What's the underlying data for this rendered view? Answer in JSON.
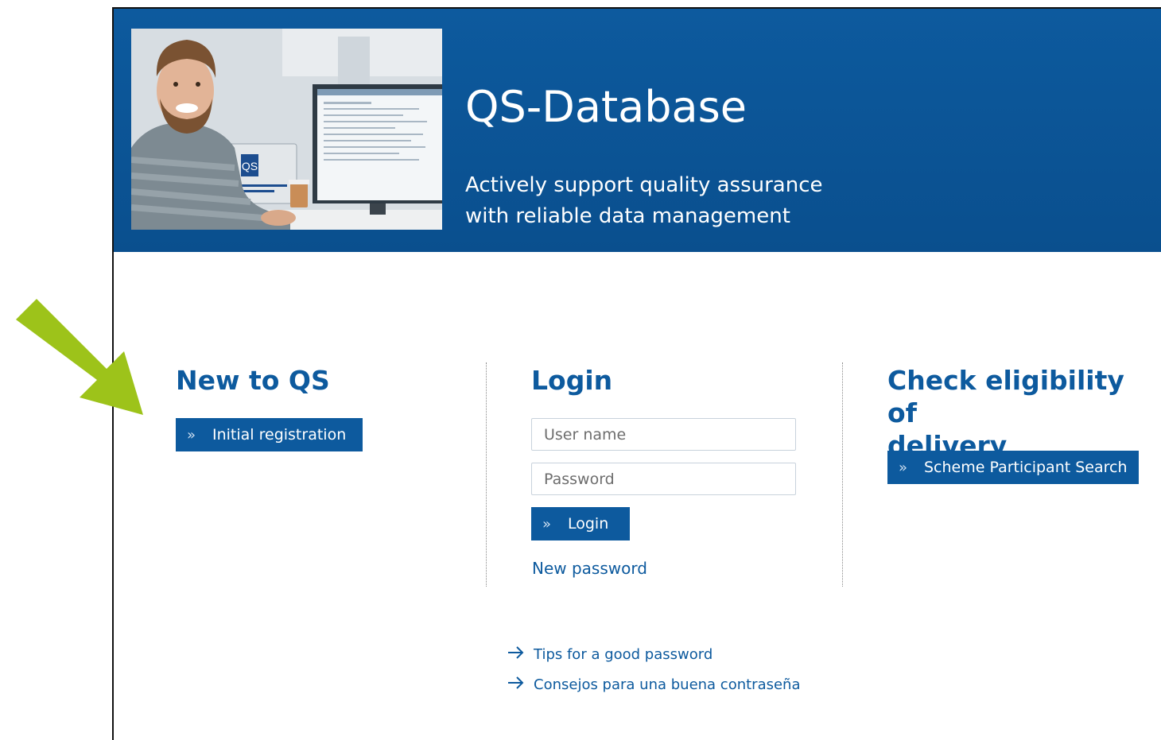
{
  "banner": {
    "title": "QS-Database",
    "subtitle_line1": "Actively support quality assurance",
    "subtitle_line2": "with reliable data management",
    "hero_screen_text": "QS"
  },
  "new_to_qs": {
    "title": "New to QS",
    "button_label": "Initial registration"
  },
  "login": {
    "title": "Login",
    "username_placeholder": "User name",
    "password_placeholder": "Password",
    "button_label": "Login",
    "new_password_link": "New password"
  },
  "eligibility": {
    "title_line1": "Check eligibility of",
    "title_line2": "delivery",
    "button_label": "Scheme Participant Search"
  },
  "tips": [
    {
      "label": "Tips for a good password"
    },
    {
      "label": "Consejos para una buena contraseña"
    }
  ],
  "colors": {
    "brand_blue": "#0d5a9e",
    "annotation_arrow": "#9dc31a"
  },
  "icons": {
    "button_chevron": "double-chevron-right-icon",
    "tip_arrow": "arrow-right-icon",
    "annotation": "green-pointer-arrow"
  }
}
